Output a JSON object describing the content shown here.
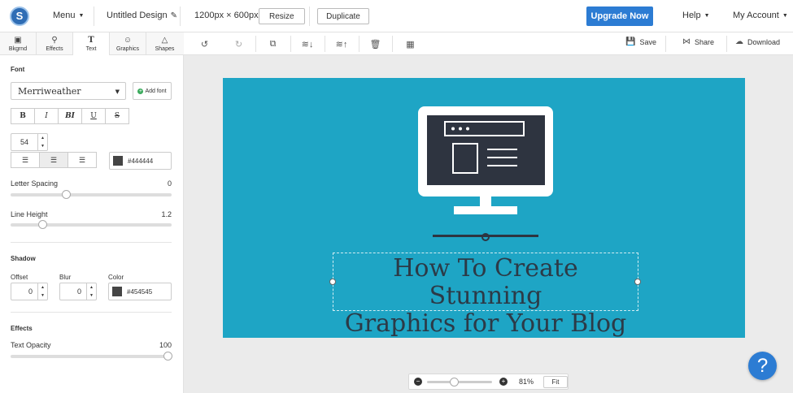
{
  "topbar": {
    "logo_letter": "S",
    "menu_label": "Menu",
    "design_title": "Untitled Design",
    "dimensions": "1200px × 600px",
    "resize_label": "Resize",
    "duplicate_label": "Duplicate",
    "upgrade_label": "Upgrade Now",
    "help_label": "Help",
    "account_label": "My Account"
  },
  "tabs": [
    {
      "label": "Bkgrnd",
      "icon": "image-icon"
    },
    {
      "label": "Effects",
      "icon": "wand-icon"
    },
    {
      "label": "Text",
      "icon": "text-icon"
    },
    {
      "label": "Graphics",
      "icon": "smiley-icon"
    },
    {
      "label": "Shapes",
      "icon": "triangle-icon"
    }
  ],
  "panel": {
    "font_title": "Font",
    "font_name": "Merriweather",
    "add_font_label": "Add font",
    "format_buttons": [
      "B",
      "I",
      "BI",
      "U",
      "S"
    ],
    "font_size": "54",
    "text_color": "#444444",
    "letter_spacing_label": "Letter Spacing",
    "letter_spacing_value": "0",
    "line_height_label": "Line Height",
    "line_height_value": "1.2",
    "shadow_title": "Shadow",
    "offset_label": "Offset",
    "offset_value": "0",
    "blur_label": "Blur",
    "blur_value": "0",
    "shadow_color_label": "Color",
    "shadow_color": "#454545",
    "effects_title": "Effects",
    "text_opacity_label": "Text Opacity",
    "text_opacity_value": "100"
  },
  "toolbar": {
    "save_label": "Save",
    "share_label": "Share",
    "download_label": "Download"
  },
  "canvas": {
    "background": "#1ea5c5",
    "headline_line1": "How To Create Stunning",
    "headline_line2": "Graphics for Your Blog",
    "text_color": "#2c3a47"
  },
  "zoom": {
    "level": "81%",
    "fit_label": "Fit",
    "slider_fraction": 0.4
  },
  "help_fab": "?"
}
